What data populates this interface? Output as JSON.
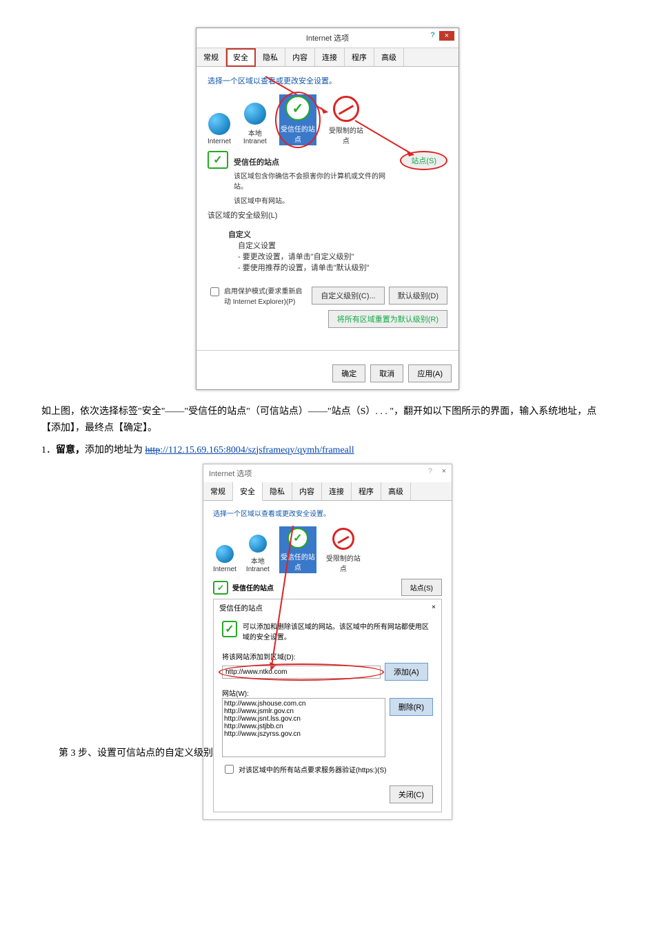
{
  "dialog1": {
    "title": "Internet 选项",
    "help_icon": "?",
    "close_icon": "×",
    "tabs": [
      "常规",
      "安全",
      "隐私",
      "内容",
      "连接",
      "程序",
      "高级"
    ],
    "active_tab": "安全",
    "prompt": "选择一个区域以查看或更改安全设置。",
    "zones": {
      "internet": "Internet",
      "intranet_l1": "本地",
      "intranet_l2": "Intranet",
      "trusted_l1": "受信任的站",
      "trusted_l2": "点",
      "restricted_l1": "受限制的站",
      "restricted_l2": "点"
    },
    "trusted_heading": "受信任的站点",
    "trusted_desc1": "该区域包含你确信不会损害你的计算机或文件的网站。",
    "trusted_desc2": "该区域中有网站。",
    "level_label": "该区域的安全级别(L)",
    "custom_title": "自定义",
    "custom_sub": "自定义设置",
    "custom_line1": "- 要更改设置，请单击\"自定义级别\"",
    "custom_line2": "- 要使用推荐的设置，请单击\"默认级别\"",
    "protected_mode": "启用保护模式(要求重新启动 Internet Explorer)(P)",
    "btn_sites": "站点(S)",
    "btn_custom_level": "自定义级别(C)...",
    "btn_default_level": "默认级别(D)",
    "btn_reset_all": "将所有区域重置为默认级别(R)",
    "btn_ok": "确定",
    "btn_cancel": "取消",
    "btn_apply": "应用(A)"
  },
  "paragraph1_a": "如上图，依次选择标签\"安全\"——\"受信任的站点\"（可信站点）——\"站点（S）. . . \"，翻开如以下图所示的界面，输入系统地址，点【添加】，最终点【确定】。",
  "note_line_prefix": "1．",
  "note_bold": "留意，",
  "note_rest": "添加的地址为  ",
  "note_url_strike": "http",
  "note_url": "://112.15.69.165:8004/szjsframeqy/qymh/frameall",
  "dialog2": {
    "title": "Internet 选项",
    "q": "?",
    "x": "×",
    "tabs": [
      "常规",
      "安全",
      "隐私",
      "内容",
      "连接",
      "程序",
      "高级"
    ],
    "prompt": "选择一个区域以查看或更改安全设置。",
    "zones": {
      "internet": "Internet",
      "intranet_l1": "本地",
      "intranet_l2": "Intranet",
      "trusted_l1": "受信任的站",
      "trusted_l2": "点",
      "restricted_l1": "受限制的站",
      "restricted_l2": "点"
    },
    "trusted_heading": "受信任的站点",
    "btn_sites": "站点(S)",
    "sub_title": "受信任的站点",
    "sub_close": "×",
    "sub_desc": "可以添加和删除该区域的网站。该区域中的所有网站都使用区域的安全设置。",
    "add_label": "将该网站添加到区域(D):",
    "add_value": "http://www.ntko.com",
    "btn_add": "添加(A)",
    "list_label": "网站(W):",
    "list": [
      "http://www.jshouse.com.cn",
      "http://www.jsmlr.gov.cn",
      "http://www.jsnt.lss.gov.cn",
      "http://www.jstjbb.cn",
      "http://www.jszyrss.gov.cn"
    ],
    "btn_remove": "删除(R)",
    "https_check": "对该区域中的所有站点要求服务器验证(https:)(S)",
    "btn_close": "关闭(C)"
  },
  "step3": "第 3 步、设置可信站点的自定义级别"
}
